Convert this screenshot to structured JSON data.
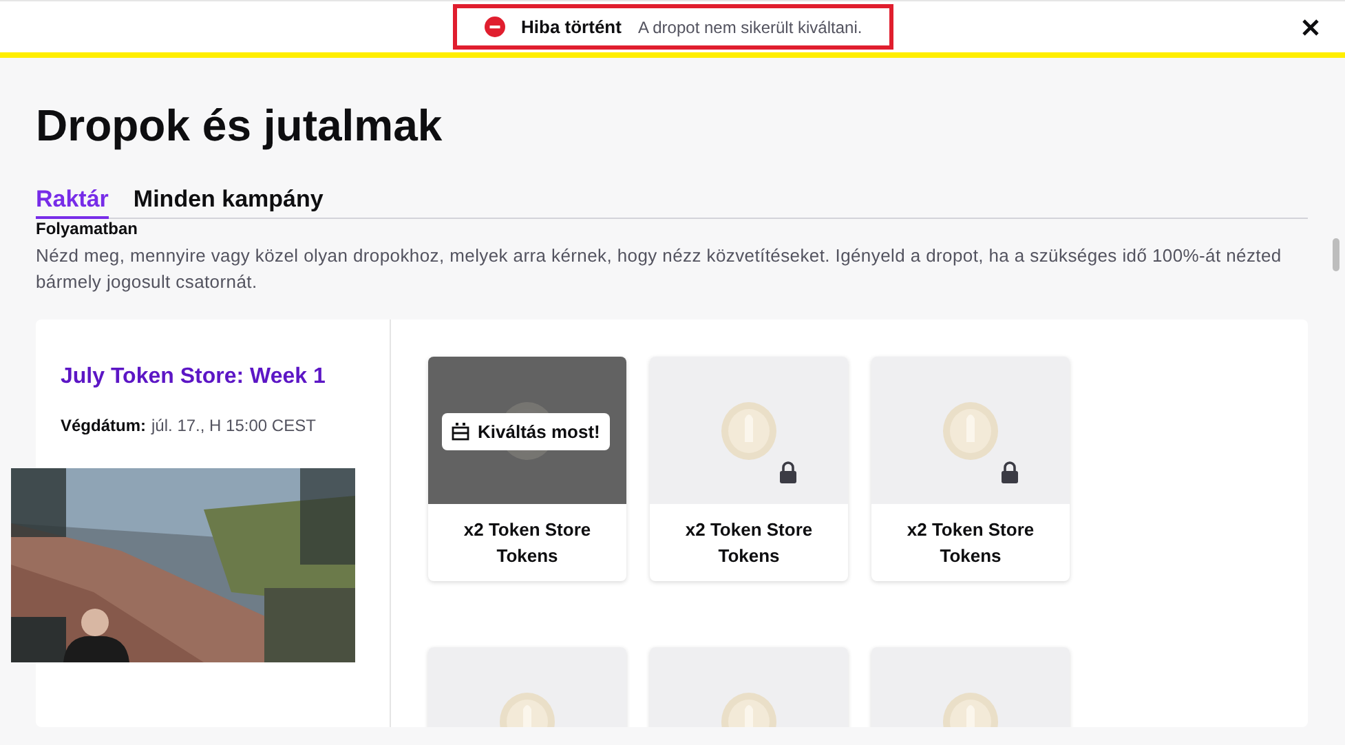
{
  "alert": {
    "title": "Hiba történt",
    "message": "A dropot nem sikerült kiváltani."
  },
  "page_title": "Dropok és jutalmak",
  "tabs": [
    {
      "label": "Raktár",
      "selected": true
    },
    {
      "label": "Minden kampány",
      "selected": false
    }
  ],
  "section_heading": "Folyamatban",
  "description": "Nézd meg, mennyire vagy közel olyan dropokhoz, melyek arra kérnek, hogy nézz közvetítéseket. Igényeld a dropot, ha a szükséges idő 100%-át nézted bármely jogosult csatornát.",
  "campaign": {
    "title": "July Token Store: Week 1",
    "end_label": "Végdátum:",
    "end_value": "júl. 17., H 15:00 CEST",
    "rewards": [
      {
        "name": "x2 Token Store Tokens",
        "locked": false,
        "claimable": true,
        "claim_label": "Kiváltás most!"
      },
      {
        "name": "x2 Token Store Tokens",
        "locked": true,
        "claimable": false
      },
      {
        "name": "x2 Token Store Tokens",
        "locked": true,
        "claimable": false
      }
    ],
    "rewards_row_2": [
      {
        "kind": "token"
      },
      {
        "kind": "token"
      },
      {
        "kind": "token"
      }
    ]
  }
}
